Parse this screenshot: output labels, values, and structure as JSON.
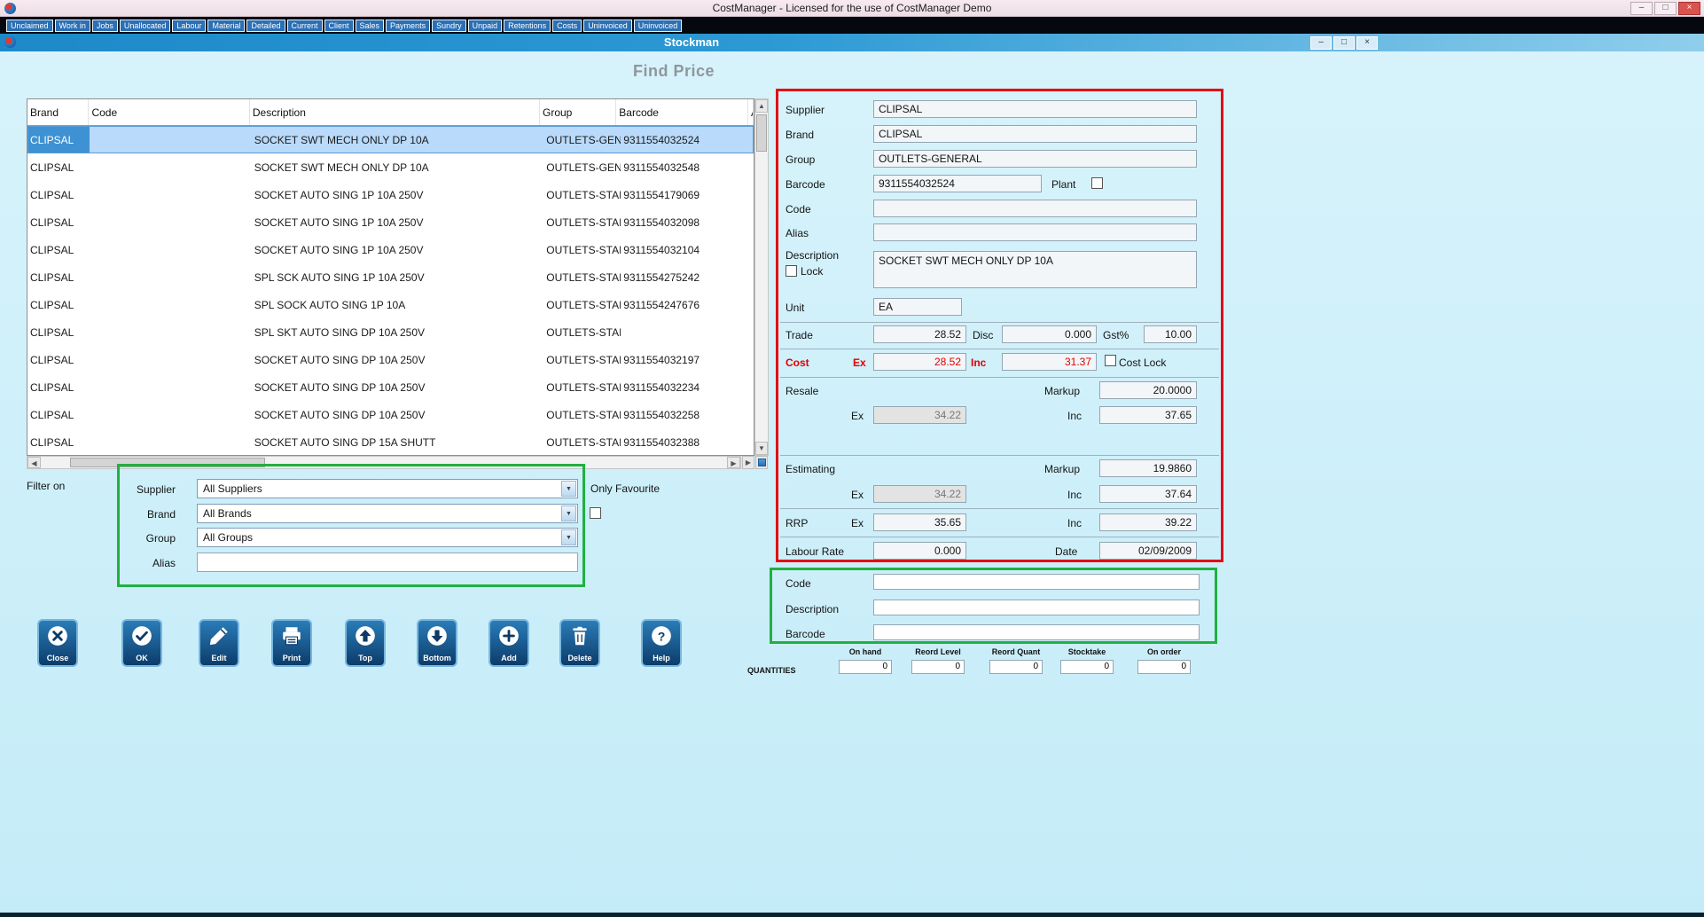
{
  "icons": {
    "minimize": "–",
    "maximize": "□",
    "close": "×",
    "dropdown": "▼",
    "scroll_up": "▲",
    "scroll_down": "▼",
    "scroll_left": "◀",
    "scroll_right": "▶"
  },
  "app": {
    "title": "CostManager - Licensed for the use of CostManager Demo",
    "tabs": [
      "Unclaimed",
      "Work in",
      "Jobs",
      "Unallocated",
      "Labour",
      "Material",
      "Detailed",
      "Current",
      "Client",
      "Sales",
      "Payments",
      "Sundry",
      "Unpaid",
      "Retentions",
      "Costs",
      "Uninvoiced",
      "Uninvoiced"
    ]
  },
  "stockman": {
    "title": "Stockman",
    "page_title": "Find Price"
  },
  "grid": {
    "columns": [
      "Brand",
      "Code",
      "Description",
      "Group",
      "Barcode",
      "A"
    ],
    "selected_index": 0,
    "rows": [
      {
        "brand": "CLIPSAL",
        "code": "",
        "description": "SOCKET SWT MECH ONLY DP 10A",
        "group": "OUTLETS-GENE",
        "barcode": "9311554032524"
      },
      {
        "brand": "CLIPSAL",
        "code": "",
        "description": "SOCKET SWT MECH ONLY DP 10A",
        "group": "OUTLETS-GENE",
        "barcode": "9311554032548"
      },
      {
        "brand": "CLIPSAL",
        "code": "",
        "description": "SOCKET AUTO SING 1P 10A 250V",
        "group": "OUTLETS-STAN",
        "barcode": "9311554179069"
      },
      {
        "brand": "CLIPSAL",
        "code": "",
        "description": "SOCKET AUTO SING 1P 10A 250V",
        "group": "OUTLETS-STAN",
        "barcode": "9311554032098"
      },
      {
        "brand": "CLIPSAL",
        "code": "",
        "description": "SOCKET AUTO SING 1P 10A 250V",
        "group": "OUTLETS-STAN",
        "barcode": "9311554032104"
      },
      {
        "brand": "CLIPSAL",
        "code": "",
        "description": "SPL SCK AUTO SING 1P 10A 250V",
        "group": "OUTLETS-STAN",
        "barcode": "9311554275242"
      },
      {
        "brand": "CLIPSAL",
        "code": "",
        "description": "SPL SOCK AUTO SING 1P 10A",
        "group": "OUTLETS-STAN",
        "barcode": "9311554247676"
      },
      {
        "brand": "CLIPSAL",
        "code": "",
        "description": "SPL SKT AUTO SING DP 10A 250V",
        "group": "OUTLETS-STAN",
        "barcode": ""
      },
      {
        "brand": "CLIPSAL",
        "code": "",
        "description": "SOCKET AUTO SING DP 10A 250V",
        "group": "OUTLETS-STAN",
        "barcode": "9311554032197"
      },
      {
        "brand": "CLIPSAL",
        "code": "",
        "description": "SOCKET AUTO SING DP 10A 250V",
        "group": "OUTLETS-STAN",
        "barcode": "9311554032234"
      },
      {
        "brand": "CLIPSAL",
        "code": "",
        "description": "SOCKET AUTO SING DP 10A 250V",
        "group": "OUTLETS-STAN",
        "barcode": "9311554032258"
      },
      {
        "brand": "CLIPSAL",
        "code": "",
        "description": "SOCKET AUTO SING DP 15A SHUTT",
        "group": "OUTLETS-STAN",
        "barcode": "9311554032388"
      }
    ]
  },
  "filter": {
    "title": "Filter on",
    "supplier_label": "Supplier",
    "supplier_value": "All Suppliers",
    "brand_label": "Brand",
    "brand_value": "All Brands",
    "group_label": "Group",
    "group_value": "All Groups",
    "alias_label": "Alias",
    "alias_value": "",
    "only_favourite_label": "Only Favourite"
  },
  "action_buttons": [
    {
      "label": "Close",
      "icon": "close-icon"
    },
    {
      "label": "OK",
      "icon": "ok-icon"
    },
    {
      "label": "Edit",
      "icon": "edit-icon"
    },
    {
      "label": "Print",
      "icon": "print-icon"
    },
    {
      "label": "Top",
      "icon": "top-icon"
    },
    {
      "label": "Bottom",
      "icon": "bottom-icon"
    },
    {
      "label": "Add",
      "icon": "add-icon"
    },
    {
      "label": "Delete",
      "icon": "delete-icon"
    },
    {
      "label": "Help",
      "icon": "help-icon"
    }
  ],
  "detail": {
    "supplier_label": "Supplier",
    "supplier": "CLIPSAL",
    "brand_label": "Brand",
    "brand": "CLIPSAL",
    "group_label": "Group",
    "group": "OUTLETS-GENERAL",
    "barcode_label": "Barcode",
    "barcode": "9311554032524",
    "plant_label": "Plant",
    "code_label": "Code",
    "code": "",
    "alias_label": "Alias",
    "alias": "",
    "description_label": "Description",
    "description": "SOCKET SWT MECH ONLY DP 10A",
    "lock_label": "Lock",
    "unit_label": "Unit",
    "unit": "EA",
    "trade_label": "Trade",
    "trade": "28.52",
    "disc_label": "Disc",
    "disc": "0.000",
    "gst_label": "Gst%",
    "gst": "10.00",
    "cost_label": "Cost",
    "ex_label": "Ex",
    "inc_label": "Inc",
    "cost_ex": "28.52",
    "cost_inc": "31.37",
    "cost_lock_label": "Cost Lock",
    "resale_label": "Resale",
    "markup_label": "Markup",
    "resale_markup": "20.0000",
    "resale_ex": "34.22",
    "resale_inc": "37.65",
    "estimating_label": "Estimating",
    "estimating_markup": "19.9860",
    "estimating_ex": "34.22",
    "estimating_inc": "37.64",
    "rrp_label": "RRP",
    "rrp_ex": "35.65",
    "rrp_inc": "39.22",
    "labour_rate_label": "Labour Rate",
    "labour_rate": "0.000",
    "date_label": "Date",
    "date": "02/09/2009"
  },
  "lookup": {
    "code_label": "Code",
    "code": "",
    "description_label": "Description",
    "description": "",
    "barcode_label": "Barcode",
    "barcode": ""
  },
  "quantities": {
    "title": "QUANTITIES",
    "columns": [
      "On hand",
      "Reord Level",
      "Reord Quant",
      "Stocktake",
      "On order"
    ],
    "values": [
      "0",
      "0",
      "0",
      "0",
      "0"
    ]
  }
}
